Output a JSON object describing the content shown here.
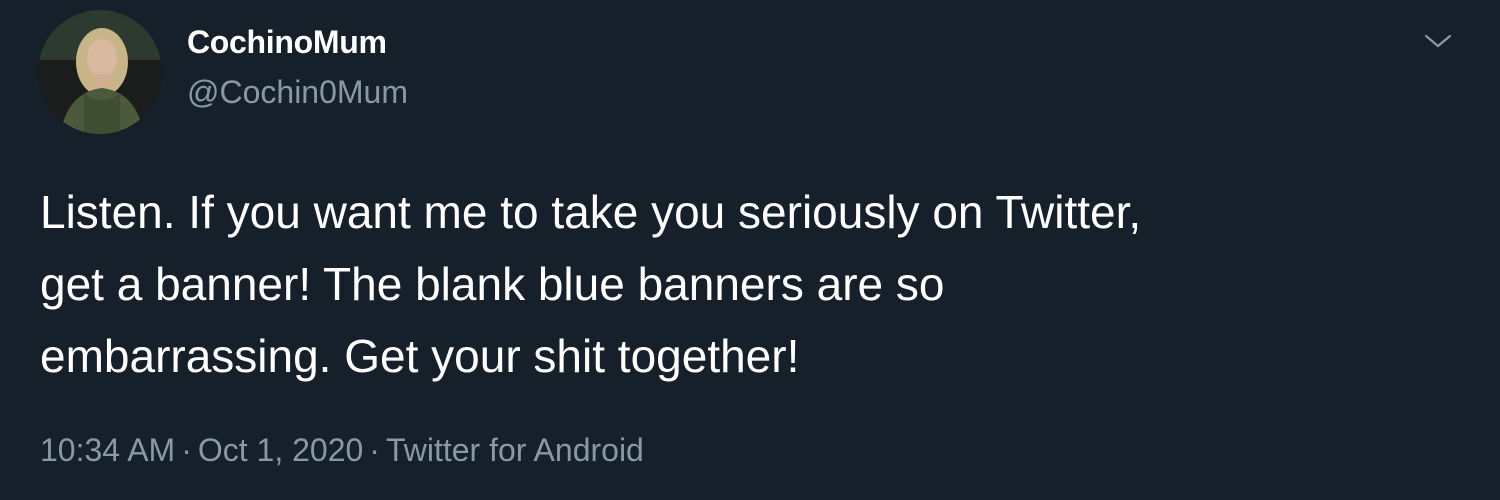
{
  "tweet": {
    "display_name": "CochinoMum",
    "handle": "@Cochin0Mum",
    "text": "Listen. If you want me to take you seriously on Twitter,\nget a banner! The blank blue banners are so\nembarrassing. Get your shit together!",
    "time": "10:34 AM",
    "separator": "·",
    "date": "Oct 1, 2020",
    "source": "Twitter for Android",
    "avatar_icon": "profile-photo",
    "menu_icon": "chevron-down-icon"
  },
  "colors": {
    "background": "#15202b",
    "primary_text": "#ffffff",
    "secondary_text": "#8899a6"
  }
}
